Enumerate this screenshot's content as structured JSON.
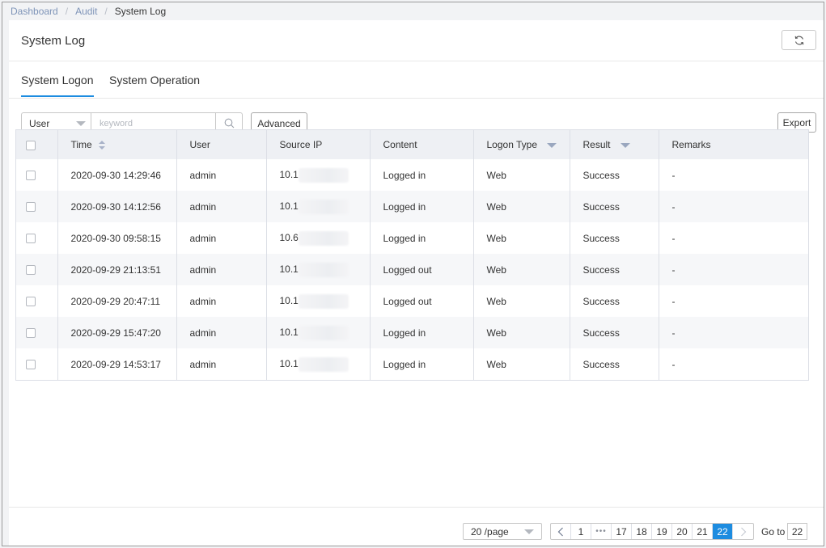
{
  "breadcrumb": {
    "items": [
      "Dashboard",
      "Audit"
    ],
    "current": "System Log",
    "separator": "/"
  },
  "page": {
    "title": "System Log"
  },
  "tabs": [
    {
      "label": "System Logon",
      "active": true
    },
    {
      "label": "System Operation",
      "active": false
    }
  ],
  "toolbar": {
    "filter_select": "User",
    "search_placeholder": "keyword",
    "advanced_label": "Advanced",
    "export_label": "Export"
  },
  "table": {
    "columns": [
      "Time",
      "User",
      "Source IP",
      "Content",
      "Logon Type",
      "Result",
      "Remarks"
    ],
    "rows": [
      {
        "time": "2020-09-30 14:29:46",
        "user": "admin",
        "ip_prefix": "10.1",
        "content": "Logged in",
        "logon_type": "Web",
        "result": "Success",
        "remarks": "-"
      },
      {
        "time": "2020-09-30 14:12:56",
        "user": "admin",
        "ip_prefix": "10.1",
        "content": "Logged in",
        "logon_type": "Web",
        "result": "Success",
        "remarks": "-"
      },
      {
        "time": "2020-09-30 09:58:15",
        "user": "admin",
        "ip_prefix": "10.6",
        "content": "Logged in",
        "logon_type": "Web",
        "result": "Success",
        "remarks": "-"
      },
      {
        "time": "2020-09-29 21:13:51",
        "user": "admin",
        "ip_prefix": "10.1",
        "content": "Logged out",
        "logon_type": "Web",
        "result": "Success",
        "remarks": "-"
      },
      {
        "time": "2020-09-29 20:47:11",
        "user": "admin",
        "ip_prefix": "10.1",
        "content": "Logged out",
        "logon_type": "Web",
        "result": "Success",
        "remarks": "-"
      },
      {
        "time": "2020-09-29 15:47:20",
        "user": "admin",
        "ip_prefix": "10.1",
        "content": "Logged in",
        "logon_type": "Web",
        "result": "Success",
        "remarks": "-"
      },
      {
        "time": "2020-09-29 14:53:17",
        "user": "admin",
        "ip_prefix": "10.1",
        "content": "Logged in",
        "logon_type": "Web",
        "result": "Success",
        "remarks": "-"
      }
    ]
  },
  "pagination": {
    "page_size": "20 /page",
    "pages": [
      "1",
      "•••",
      "17",
      "18",
      "19",
      "20",
      "21",
      "22"
    ],
    "current": "22",
    "goto_label": "Go to",
    "goto_value": "22"
  },
  "icons": {
    "refresh": "refresh-icon",
    "search": "search-icon",
    "sort": "sort-icon",
    "filter": "filter-icon",
    "prev": "chevron-left-icon",
    "next": "chevron-right-icon"
  },
  "colors": {
    "accent": "#1d8ce0",
    "header_bg": "#eef0f4",
    "breadcrumb_link": "#7e94b8"
  }
}
